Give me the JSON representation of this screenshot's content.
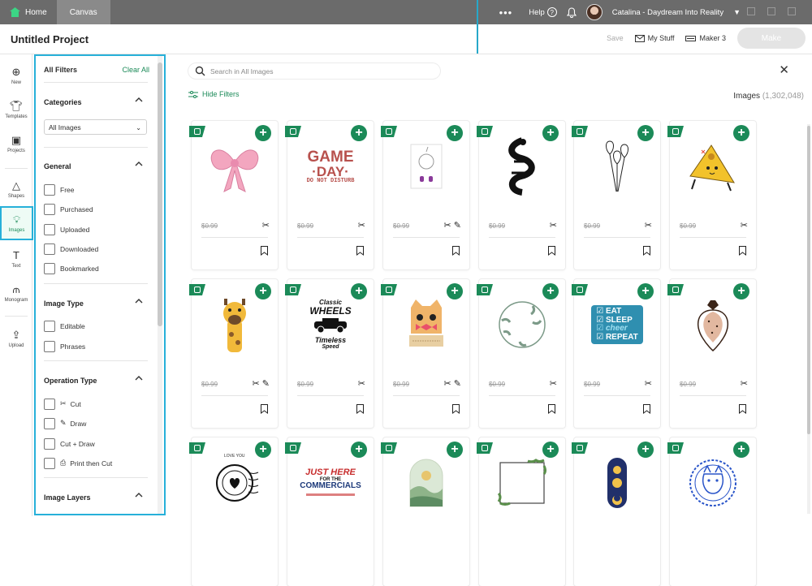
{
  "titlebar": {
    "home_tab": "Home",
    "canvas_tab": "Canvas",
    "more": "•••",
    "help": "Help",
    "help_glyph": "?",
    "user_name": "Catalina - Daydream Into Reality"
  },
  "header": {
    "project_title": "Untitled Project",
    "save": "Save",
    "my_stuff": "My Stuff",
    "machine": "Maker 3",
    "make": "Make"
  },
  "lefttools": [
    {
      "label": "New",
      "icon": "plus-circle-icon"
    },
    {
      "label": "Templates",
      "icon": "shirt-icon"
    },
    {
      "label": "Projects",
      "icon": "projects-icon"
    },
    {
      "label": "Shapes",
      "icon": "shapes-icon"
    },
    {
      "label": "Images",
      "icon": "lightbulb-icon"
    },
    {
      "label": "Text",
      "icon": "text-icon"
    },
    {
      "label": "Monogram",
      "icon": "monogram-icon"
    },
    {
      "label": "Upload",
      "icon": "upload-icon"
    }
  ],
  "filters": {
    "title": "All Filters",
    "clear": "Clear All",
    "categories_title": "Categories",
    "categories_value": "All Images",
    "general_title": "General",
    "general_items": [
      "Free",
      "Purchased",
      "Uploaded",
      "Downloaded",
      "Bookmarked"
    ],
    "image_type_title": "Image Type",
    "image_type_items": [
      "Editable",
      "Phrases"
    ],
    "operation_title": "Operation Type",
    "operation_items": [
      "Cut",
      "Draw",
      "Cut + Draw",
      "Print then Cut"
    ],
    "layers_title": "Image Layers"
  },
  "main": {
    "search_placeholder": "Search in All Images",
    "hide_filters": "Hide Filters",
    "images_label": "Images",
    "images_count": "(1,302,048)",
    "close": "✕"
  },
  "cards": [
    {
      "price": "$0.99",
      "ops": "✂",
      "art": "bow"
    },
    {
      "price": "$0.99",
      "ops": "✂",
      "art": "gameday"
    },
    {
      "price": "$0.99",
      "ops": "✂ ✎",
      "art": "unicorn-card"
    },
    {
      "price": "$0.99",
      "ops": "✂",
      "art": "snake"
    },
    {
      "price": "$0.99",
      "ops": "✂",
      "art": "balloons"
    },
    {
      "price": "$0.99",
      "ops": "✂",
      "art": "nachos"
    },
    {
      "price": "$0.99",
      "ops": "✂ ✎",
      "art": "giraffe"
    },
    {
      "price": "$0.99",
      "ops": "✂",
      "art": "wheels"
    },
    {
      "price": "$0.99",
      "ops": "✂ ✎",
      "art": "cat"
    },
    {
      "price": "$0.99",
      "ops": "✂",
      "art": "wreath"
    },
    {
      "price": "$0.99",
      "ops": "✂",
      "art": "eatsleep"
    },
    {
      "price": "$0.99",
      "ops": "✂",
      "art": "strawberry"
    },
    {
      "price": "",
      "ops": "",
      "art": "stamp"
    },
    {
      "price": "",
      "ops": "",
      "art": "commercials"
    },
    {
      "price": "",
      "ops": "",
      "art": "arch"
    },
    {
      "price": "",
      "ops": "",
      "art": "frame"
    },
    {
      "price": "",
      "ops": "",
      "art": "tarot"
    },
    {
      "price": "",
      "ops": "",
      "art": "frenchie"
    }
  ],
  "art_text": {
    "gameday_1": "GAME",
    "gameday_2": "·DAY·",
    "gameday_3": "DO NOT DISTURB",
    "wheels_1": "Classic",
    "wheels_2": "WHEELS",
    "wheels_3": "Timeless",
    "wheels_4": "Speed",
    "eat_1": "EAT",
    "eat_2": "SLEEP",
    "eat_3": "cheer",
    "eat_4": "REPEAT",
    "commercials_1": "JUST HERE",
    "commercials_2": "FOR THE",
    "commercials_3": "COMMERCIALS",
    "stamp_1": "LOVE YOU"
  },
  "colors": {
    "accent_green": "#1b8a58",
    "highlight_blue": "#27b0d9",
    "titlebar": "#6b6b6b"
  }
}
